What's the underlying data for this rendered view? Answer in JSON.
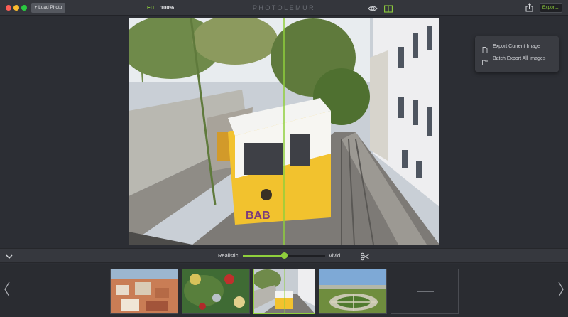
{
  "window": {
    "title": "PHOTOLEMUR"
  },
  "toolbar": {
    "load_photo_label": "+ Load Photo",
    "fit_label": "FIT",
    "zoom_label": "100%",
    "export_label": "Export...",
    "icons": [
      "eye-icon",
      "compare-icon",
      "share-icon"
    ]
  },
  "export_menu": {
    "items": [
      {
        "label": "Export Current Image",
        "icon": "file-icon"
      },
      {
        "label": "Batch Export All Images",
        "icon": "folder-icon"
      }
    ]
  },
  "controls": {
    "left_label": "Realistic",
    "right_label": "Vivid",
    "slider_value": 0.5
  },
  "filmstrip": {
    "thumbnails": [
      {
        "icon": "city-rooftops-thumbnail",
        "selected": false
      },
      {
        "icon": "christmas-ornaments-thumbnail",
        "selected": false
      },
      {
        "icon": "tram-street-thumbnail",
        "selected": true
      },
      {
        "icon": "park-garden-thumbnail",
        "selected": false
      }
    ],
    "add_icon": "plus-icon"
  },
  "colors": {
    "accent": "#8fcf3c",
    "background": "#2c2e34",
    "titlebar": "#34363c",
    "menu": "#3a3c42"
  }
}
